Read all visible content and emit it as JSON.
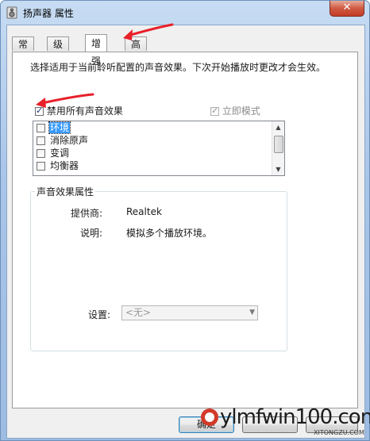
{
  "window": {
    "title": "扬声器 属性",
    "close_label": "✕"
  },
  "tabs": [
    {
      "label": "常规",
      "active": false
    },
    {
      "label": "级别",
      "active": false
    },
    {
      "label": "增强",
      "active": true
    },
    {
      "label": "高级",
      "active": false
    }
  ],
  "enhancements": {
    "description": "选择适用于当前聆听配置的声音效果。下次开始播放时更改才会生效。",
    "disable_all": {
      "label": "禁用所有声音效果",
      "checked": true
    },
    "immediate_mode": {
      "label": "立即模式",
      "checked": true,
      "disabled": true
    },
    "effects": [
      {
        "label": "环境",
        "checked": false,
        "selected": true
      },
      {
        "label": "消除原声",
        "checked": false,
        "selected": false
      },
      {
        "label": "变调",
        "checked": false,
        "selected": false
      },
      {
        "label": "均衡器",
        "checked": false,
        "selected": false
      }
    ],
    "properties": {
      "title": "声音效果属性",
      "provider_label": "提供商:",
      "provider_value": "Realtek",
      "description_label": "说明:",
      "description_value": "模拟多个播放环境。",
      "settings_label": "设置:",
      "settings_value": "<无>"
    }
  },
  "buttons": {
    "ok_label": "确定"
  },
  "watermark": {
    "text": "ylmfwin100.com",
    "sub": "XITONGZU.COM"
  },
  "colors": {
    "accent": "#3399ff",
    "annotation_arrow": "#e8212a"
  }
}
